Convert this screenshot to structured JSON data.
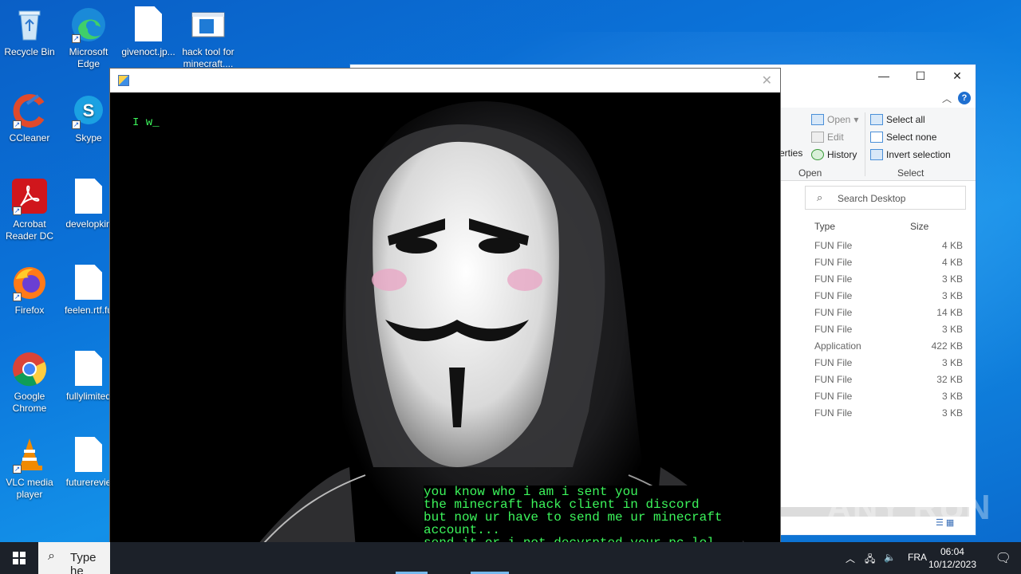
{
  "desktop": {
    "icons": [
      {
        "label": "Recycle Bin"
      },
      {
        "label": "Microsoft Edge"
      },
      {
        "label": "givenoct.jp..."
      },
      {
        "label": "hack tool for minecraft...."
      },
      {
        "label": "CCleaner"
      },
      {
        "label": "Skype"
      },
      {
        "label": "Acrobat Reader DC"
      },
      {
        "label": "developkin"
      },
      {
        "label": "Firefox"
      },
      {
        "label": "feelen.rtf.fu"
      },
      {
        "label": "Google Chrome"
      },
      {
        "label": "fullylimited"
      },
      {
        "label": "VLC media player"
      },
      {
        "label": "futurerevie"
      }
    ]
  },
  "explorer": {
    "ribbon": {
      "open": "Open",
      "edit": "Edit",
      "history": "History",
      "open_group": "Open",
      "select_all": "Select all",
      "select_none": "Select none",
      "invert_selection": "Invert selection",
      "select_group": "Select",
      "properties_partial": "erties"
    },
    "search_placeholder": "Search Desktop",
    "columns": {
      "type": "Type",
      "size": "Size"
    },
    "rows": [
      {
        "type": "FUN File",
        "size": "4 KB"
      },
      {
        "type": "FUN File",
        "size": "4 KB"
      },
      {
        "type": "FUN File",
        "size": "3 KB"
      },
      {
        "type": "FUN File",
        "size": "3 KB"
      },
      {
        "type": "FUN File",
        "size": "14 KB"
      },
      {
        "type": "FUN File",
        "size": "3 KB"
      },
      {
        "type": "Application",
        "size": "422 KB"
      },
      {
        "type": "FUN File",
        "size": "3 KB"
      },
      {
        "type": "FUN File",
        "size": "32 KB"
      },
      {
        "type": "FUN File",
        "size": "3 KB"
      },
      {
        "type": "FUN File",
        "size": "3 KB"
      }
    ]
  },
  "payload": {
    "typing_text": "I w_",
    "message": "you know who i am i sent you\nthe minecraft hack client in discord\nbut now ur have to send me ur minecraft\naccount...\nsend it or i not decyrpted your pc lol"
  },
  "taskbar": {
    "search_text": "Type he",
    "language": "FRA",
    "time": "06:04",
    "date": "10/12/2023"
  },
  "watermark": "ANY RUN"
}
